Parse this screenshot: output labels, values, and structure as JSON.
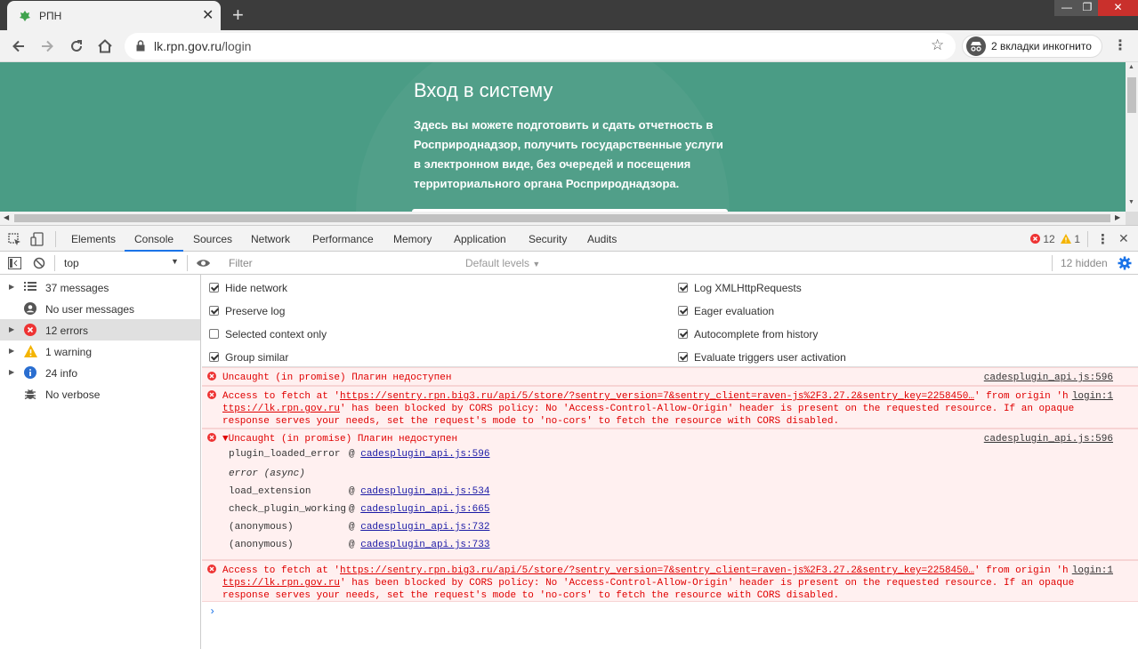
{
  "browser": {
    "tab_title": "РПН",
    "url_host": "lk.rpn.gov.ru",
    "url_path": "/login",
    "incognito_label": "2 вкладки инкогнито"
  },
  "page": {
    "heading": "Вход в систему",
    "description_lines": [
      "Здесь вы можете подготовить и сдать отчетность в",
      "Росприроднадзор, получить государственные услуги",
      "в электронном виде, без очередей и посещения",
      "территориального органа Росприроднадзора."
    ]
  },
  "devtools": {
    "tabs": [
      "Elements",
      "Console",
      "Sources",
      "Network",
      "Performance",
      "Memory",
      "Application",
      "Security",
      "Audits"
    ],
    "active_tab": "Console",
    "error_count": "12",
    "warning_count": "1",
    "context": "top",
    "filter_placeholder": "Filter",
    "levels_label": "Default levels",
    "hidden_label": "12 hidden",
    "sidebar": [
      {
        "label": "37 messages",
        "icon": "list-icon"
      },
      {
        "label": "No user messages",
        "icon": "user-icon"
      },
      {
        "label": "12 errors",
        "icon": "error-icon"
      },
      {
        "label": "1 warning",
        "icon": "warning-icon"
      },
      {
        "label": "24 info",
        "icon": "info-icon"
      },
      {
        "label": "No verbose",
        "icon": "bug-icon"
      }
    ],
    "settings_left": [
      {
        "label": "Hide network",
        "checked": true
      },
      {
        "label": "Preserve log",
        "checked": true
      },
      {
        "label": "Selected context only",
        "checked": false
      },
      {
        "label": "Group similar",
        "checked": true
      }
    ],
    "settings_right": [
      {
        "label": "Log XMLHttpRequests",
        "checked": true
      },
      {
        "label": "Eager evaluation",
        "checked": true
      },
      {
        "label": "Autocomplete from history",
        "checked": true
      },
      {
        "label": "Evaluate triggers user activation",
        "checked": true
      }
    ],
    "messages": {
      "m1": {
        "text": "Uncaught (in promise) Плагин недоступен",
        "source": "cadesplugin_api.js:596"
      },
      "m2": {
        "pre": "Access to fetch at '",
        "link": "https://sentry.rpn.big3.ru/api/5/store/?sentry_version=7&sentry_client=raven-js%2F3.27.2&sentry_key=2258450…",
        "mid": "' from origin 'h",
        "link2": "ttps://lk.rpn.gov.ru",
        "line2": "' has been blocked by CORS policy: No 'Access-Control-Allow-Origin' header is present on the requested resource. If an opaque",
        "line3": "response serves your needs, set the request's mode to 'no-cors' to fetch the resource with CORS disabled.",
        "source": "login:1"
      },
      "m3": {
        "text": "▼Uncaught (in promise) Плагин недоступен",
        "source": "cadesplugin_api.js:596",
        "stack": [
          {
            "fn": "plugin_loaded_error",
            "loc": "cadesplugin_api.js:596"
          },
          {
            "fn": "load_extension",
            "loc": "cadesplugin_api.js:534"
          },
          {
            "fn": "check_plugin_working",
            "loc": "cadesplugin_api.js:665"
          },
          {
            "fn": "(anonymous)",
            "loc": "cadesplugin_api.js:732"
          },
          {
            "fn": "(anonymous)",
            "loc": "cadesplugin_api.js:733"
          }
        ],
        "async": "error (async)"
      },
      "m4": {
        "pre": "Access to fetch at '",
        "link": "https://sentry.rpn.big3.ru/api/5/store/?sentry_version=7&sentry_client=raven-js%2F3.27.2&sentry_key=2258450…",
        "mid": "' from origin 'h",
        "link2": "ttps://lk.rpn.gov.ru",
        "line2": "' has been blocked by CORS policy: No 'Access-Control-Allow-Origin' header is present on the requested resource. If an opaque",
        "line3": "response serves your needs, set the request's mode to 'no-cors' to fetch the resource with CORS disabled.",
        "source": "login:1"
      }
    },
    "at_sign": "@",
    "prompt": "›"
  },
  "colors": {
    "page_bg": "#4a9c85",
    "error_red": "#e00000",
    "error_bg": "#fff0f0",
    "accent": "#1a73e8"
  }
}
